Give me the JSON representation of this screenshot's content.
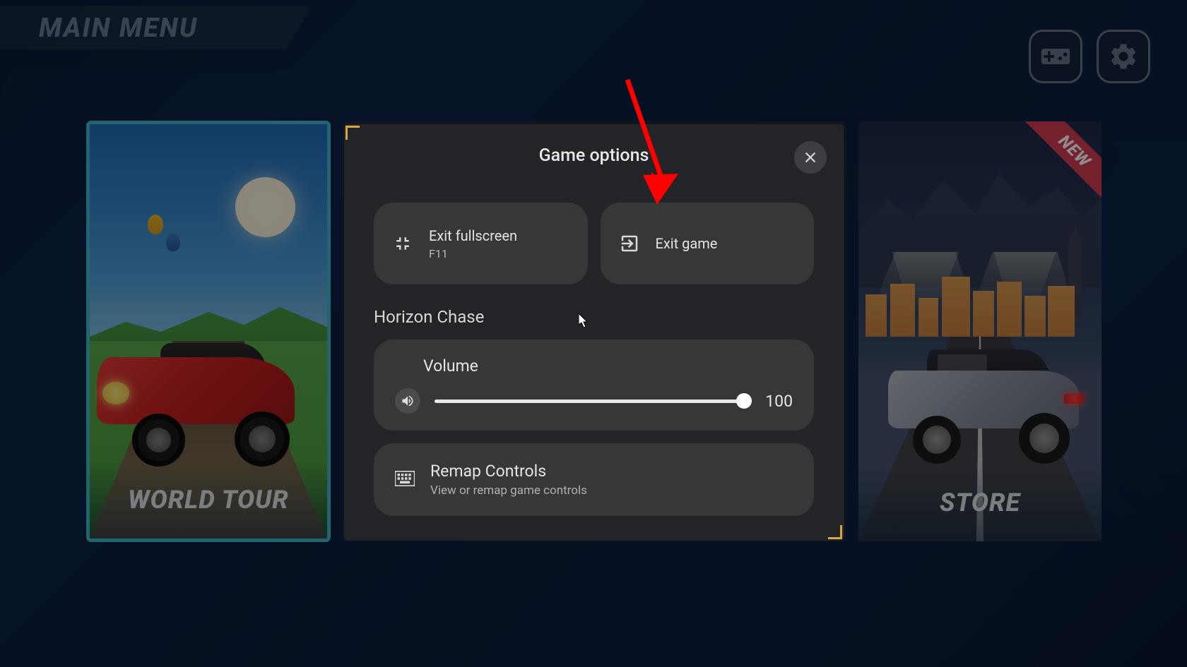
{
  "header": {
    "title": "MAIN MENU"
  },
  "cards": {
    "world_tour": {
      "label": "WORLD TOUR"
    },
    "store": {
      "label": "STORE",
      "ribbon": "NEW"
    }
  },
  "modal": {
    "title": "Game options",
    "exit_fullscreen": {
      "label": "Exit fullscreen",
      "shortcut": "F11"
    },
    "exit_game": {
      "label": "Exit game"
    },
    "section": "Horizon Chase",
    "volume": {
      "label": "Volume",
      "value": "100"
    },
    "remap": {
      "label": "Remap Controls",
      "sub": "View or remap game controls"
    }
  }
}
